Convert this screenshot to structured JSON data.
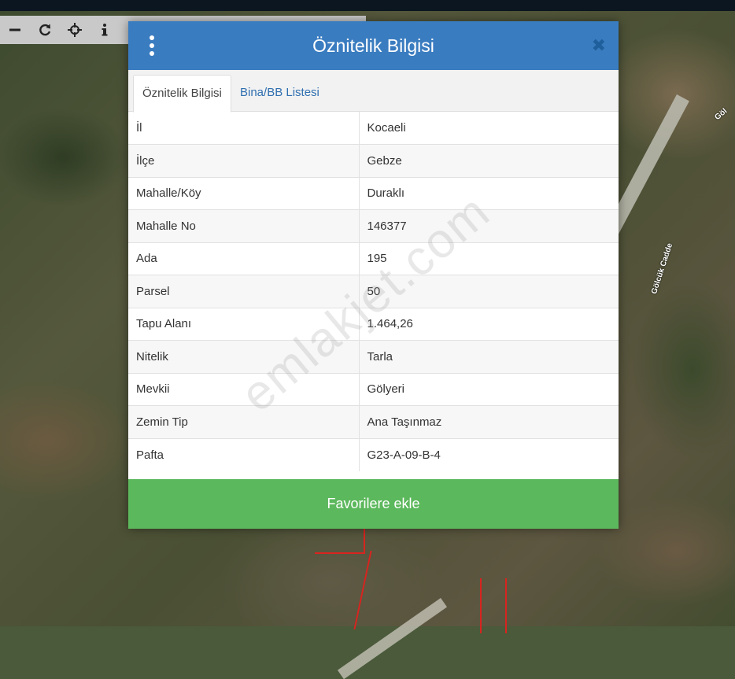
{
  "map": {
    "road_label_1": "Gölcük Cadde",
    "road_label_2": "Göl"
  },
  "toolbar": {
    "zoom_out_icon": "minus-icon",
    "refresh_icon": "refresh-icon",
    "locate_icon": "crosshair-icon",
    "info_icon": "info-icon"
  },
  "modal": {
    "title": "Öznitelik Bilgisi",
    "tabs": [
      {
        "label": "Öznitelik Bilgisi",
        "active": true
      },
      {
        "label": "Bina/BB Listesi",
        "active": false
      }
    ],
    "rows": [
      {
        "key": "İl",
        "value": "Kocaeli"
      },
      {
        "key": "İlçe",
        "value": "Gebze"
      },
      {
        "key": "Mahalle/Köy",
        "value": "Duraklı"
      },
      {
        "key": "Mahalle No",
        "value": "146377"
      },
      {
        "key": "Ada",
        "value": "195"
      },
      {
        "key": "Parsel",
        "value": "50"
      },
      {
        "key": "Tapu Alanı",
        "value": "1.464,26"
      },
      {
        "key": "Nitelik",
        "value": "Tarla"
      },
      {
        "key": "Mevkii",
        "value": "Gölyeri"
      },
      {
        "key": "Zemin Tip",
        "value": "Ana Taşınmaz"
      },
      {
        "key": "Pafta",
        "value": "G23-A-09-B-4"
      }
    ],
    "favorite_button": "Favorilere ekle"
  },
  "watermark": "emlakjet.com",
  "colors": {
    "header": "#3a7cc0",
    "favorite": "#5cb85c",
    "tab_link": "#2f6fb0",
    "parcel_border": "#d8241f"
  }
}
